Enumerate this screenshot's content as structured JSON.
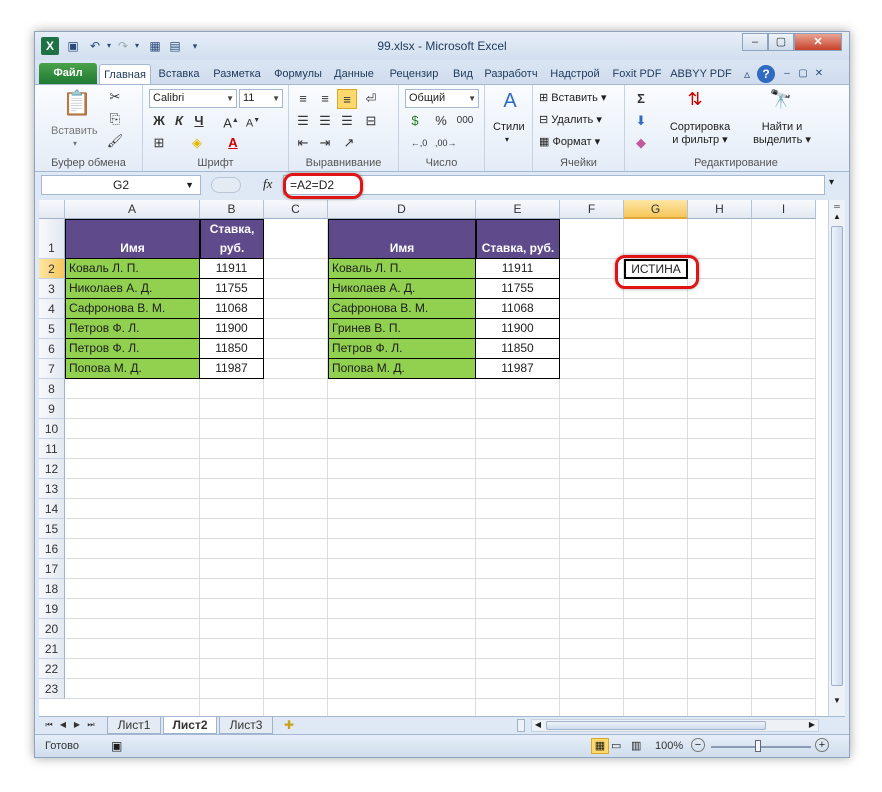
{
  "window": {
    "title": "99.xlsx - Microsoft Excel"
  },
  "tabs": {
    "file": "Файл",
    "items": [
      "Главная",
      "Вставка",
      "Разметка",
      "Формулы",
      "Данные",
      "Рецензир",
      "Вид",
      "Разработч",
      "Надстрой",
      "Foxit PDF",
      "ABBYY PDF"
    ]
  },
  "ribbon": {
    "clipboard": {
      "label": "Буфер обмена",
      "paste": "Вставить"
    },
    "font": {
      "label": "Шрифт",
      "name": "Calibri",
      "size": "11",
      "bold": "Ж",
      "italic": "К",
      "underline": "Ч"
    },
    "alignment": {
      "label": "Выравнивание"
    },
    "number": {
      "label": "Число",
      "format": "Общий"
    },
    "styles": {
      "label": "Стили"
    },
    "cells": {
      "label": "Ячейки",
      "insert": "Вставить",
      "delete": "Удалить",
      "format": "Формат"
    },
    "editing": {
      "label": "Редактирование",
      "sort_line1": "Сортировка",
      "sort_line2": "и фильтр",
      "find_line1": "Найти и",
      "find_line2": "выделить"
    }
  },
  "formula_bar": {
    "name_box": "G2",
    "fx": "fx",
    "formula": "=A2=D2"
  },
  "columns": [
    "A",
    "B",
    "C",
    "D",
    "E",
    "F",
    "G",
    "H",
    "I"
  ],
  "rows": [
    "1",
    "2",
    "3",
    "4",
    "5",
    "6",
    "7",
    "8",
    "9",
    "10",
    "11",
    "12",
    "13",
    "14",
    "15",
    "16",
    "17",
    "18",
    "19",
    "20",
    "21",
    "22",
    "23"
  ],
  "table1": {
    "header_name": "Имя",
    "header_rate_line1": "Ставка,",
    "header_rate_line2": "руб.",
    "rows": [
      [
        "Коваль Л. П.",
        "11911"
      ],
      [
        "Николаев А. Д.",
        "11755"
      ],
      [
        "Сафронова В. М.",
        "11068"
      ],
      [
        "Петров Ф. Л.",
        "11900"
      ],
      [
        "Петров Ф. Л.",
        "11850"
      ],
      [
        "Попова М. Д.",
        "11987"
      ]
    ]
  },
  "table2": {
    "header_name": "Имя",
    "header_rate": "Ставка, руб.",
    "rows": [
      [
        "Коваль Л. П.",
        "11911"
      ],
      [
        "Николаев А. Д.",
        "11755"
      ],
      [
        "Сафронова В. М.",
        "11068"
      ],
      [
        "Гринев В. П.",
        "11900"
      ],
      [
        "Петров Ф. Л.",
        "11850"
      ],
      [
        "Попова М. Д.",
        "11987"
      ]
    ]
  },
  "result_cell": {
    "value": "ИСТИНА"
  },
  "sheets": [
    "Лист1",
    "Лист2",
    "Лист3"
  ],
  "active_sheet": "Лист2",
  "status": {
    "ready": "Готово",
    "zoom": "100%"
  },
  "colors": {
    "header_purple": "#5f4b8b",
    "name_green": "#92d050",
    "highlight_red": "#e01414"
  }
}
